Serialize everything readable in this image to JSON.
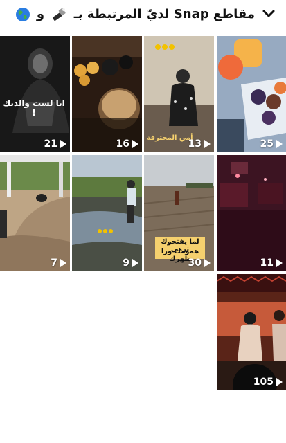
{
  "header": {
    "title": "مقاطع Snap لديّ المرتبطة بـ",
    "conjunction": "و",
    "icons": [
      "flashlight-icon",
      "globe-icon"
    ]
  },
  "tiles": [
    {
      "count": "21",
      "caption": "انا لست والدتك !"
    },
    {
      "count": "16",
      "caption": ""
    },
    {
      "count": "13",
      "caption": "أمي المحترفة"
    },
    {
      "count": "25",
      "caption": ""
    },
    {
      "count": "7",
      "caption": ""
    },
    {
      "count": "9",
      "caption": ""
    },
    {
      "count": "30",
      "caption_line1": "لما يفتحوك ترمي",
      "caption_line2": "همومك ورا ظهرك"
    },
    {
      "count": "11",
      "caption": ""
    },
    {
      "count": "105",
      "caption": ""
    }
  ],
  "colors": {
    "accent": "#f5d06e",
    "text": "#111111"
  }
}
